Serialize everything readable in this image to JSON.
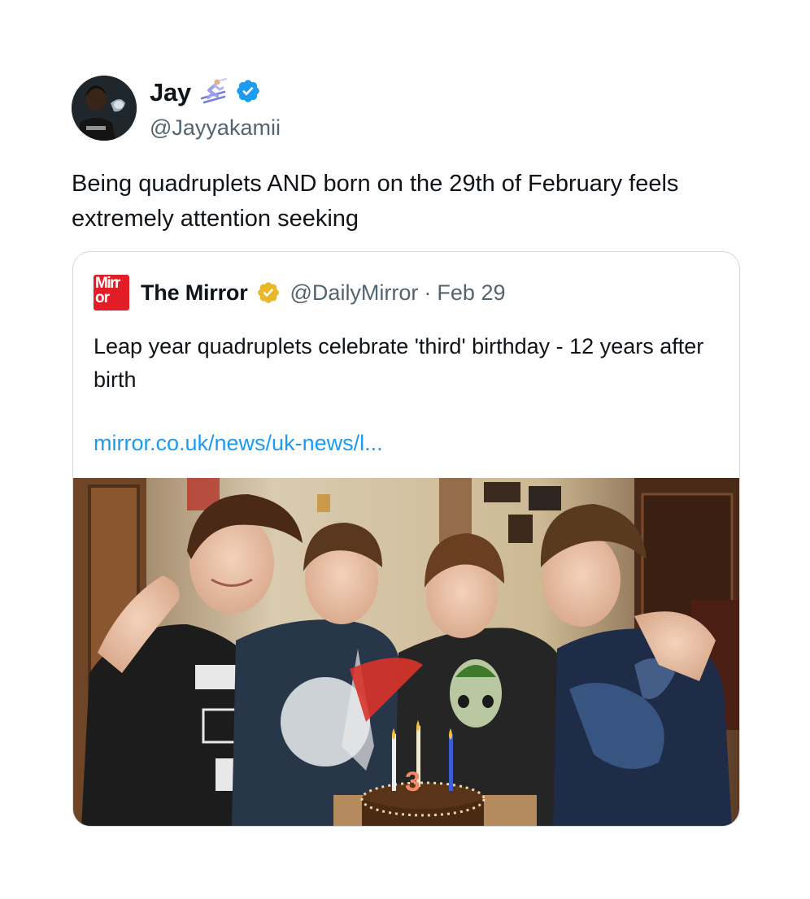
{
  "author": {
    "display_name": "Jay",
    "emoji_icon": "skier-emoji-icon",
    "verified_icon": "blue-verified-badge-icon",
    "handle": "@Jayyakamii"
  },
  "tweet": {
    "text": "Being quadruplets AND born on the 29th of February feels extremely attention seeking"
  },
  "quote": {
    "logo_text_line1": "Mirr",
    "logo_text_line2": "or",
    "name": "The Mirror",
    "verified_icon": "gold-verified-badge-icon",
    "handle": "@DailyMirror",
    "separator": "·",
    "date": "Feb 29",
    "text": "Leap year quadruplets celebrate 'third' birthday - 12 years after birth",
    "link": "mirror.co.uk/news/uk-news/l...",
    "photo_alt": "four-boys-birthday-cake-photo",
    "cake_candle_number": "3"
  },
  "colors": {
    "text": "#0f1419",
    "secondary": "#536471",
    "link": "#1d9bf0",
    "verified_blue": "#1d9bf0",
    "verified_gold": "#e8b829",
    "mirror_red": "#e21d26",
    "border": "#cfd9de"
  }
}
